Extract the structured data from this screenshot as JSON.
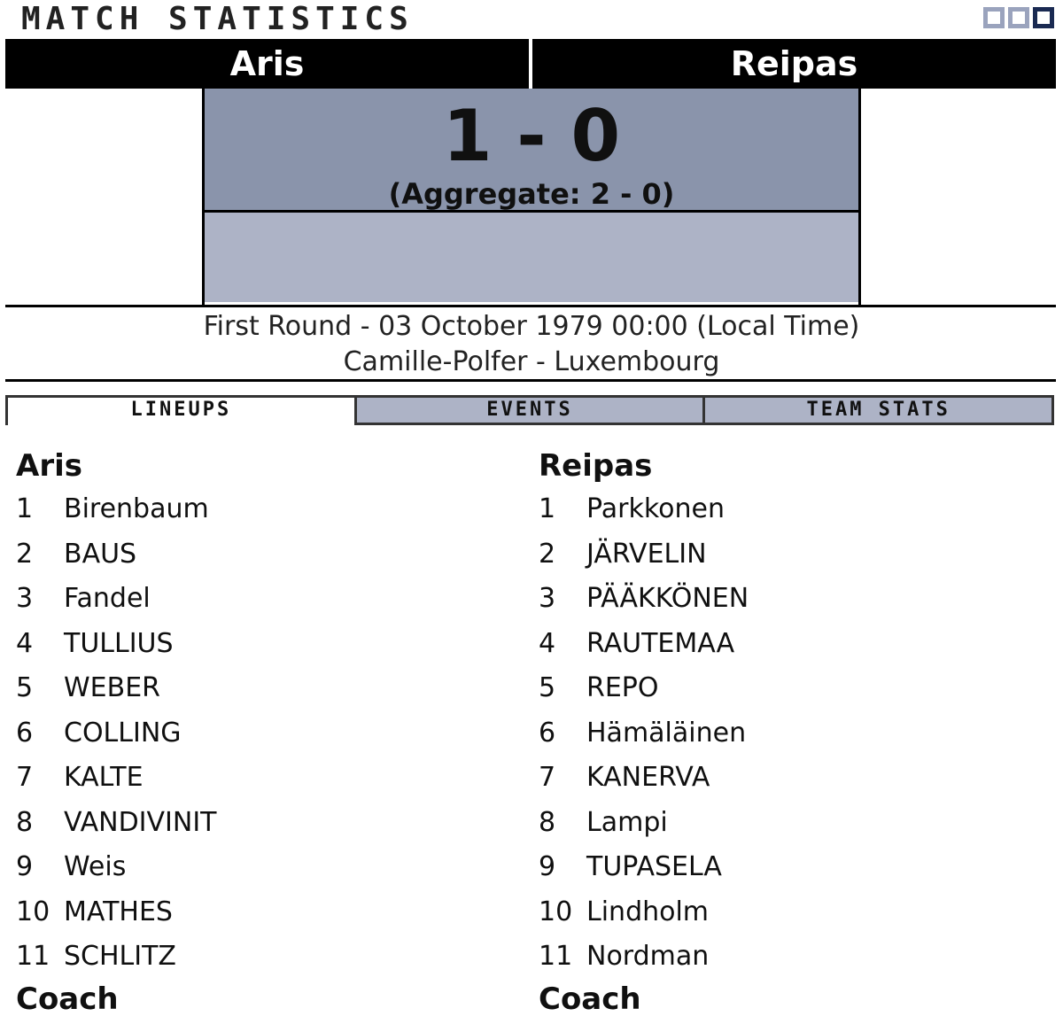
{
  "header": {
    "title": "MATCH STATISTICS"
  },
  "match": {
    "home_team": "Aris",
    "away_team": "Reipas",
    "score": "1 - 0",
    "aggregate": "(Aggregate: 2 - 0)",
    "round_info": "First Round - 03 October 1979 00:00 (Local Time)",
    "venue": "Camille-Polfer - Luxembourg"
  },
  "tabs": [
    "LINEUPS",
    "EVENTS",
    "TEAM STATS"
  ],
  "lineups": {
    "home": {
      "team": "Aris",
      "players": [
        {
          "num": "1",
          "name": "Birenbaum"
        },
        {
          "num": "2",
          "name": "BAUS"
        },
        {
          "num": "3",
          "name": "Fandel"
        },
        {
          "num": "4",
          "name": "TULLIUS"
        },
        {
          "num": "5",
          "name": "WEBER"
        },
        {
          "num": "6",
          "name": "COLLING"
        },
        {
          "num": "7",
          "name": "KALTE"
        },
        {
          "num": "8",
          "name": "VANDIVINIT"
        },
        {
          "num": "9",
          "name": "Weis"
        },
        {
          "num": "10",
          "name": "MATHES"
        },
        {
          "num": "11",
          "name": "SCHLITZ"
        }
      ],
      "coach_label": "Coach"
    },
    "away": {
      "team": "Reipas",
      "players": [
        {
          "num": "1",
          "name": "Parkkonen"
        },
        {
          "num": "2",
          "name": "JÄRVELIN"
        },
        {
          "num": "3",
          "name": "PÄÄKKÖNEN"
        },
        {
          "num": "4",
          "name": "RAUTEMAA"
        },
        {
          "num": "5",
          "name": "REPO"
        },
        {
          "num": "6",
          "name": "Hämäläinen"
        },
        {
          "num": "7",
          "name": "KANERVA"
        },
        {
          "num": "8",
          "name": "Lampi"
        },
        {
          "num": "9",
          "name": "TUPASELA"
        },
        {
          "num": "10",
          "name": "Lindholm"
        },
        {
          "num": "11",
          "name": "Nordman"
        }
      ],
      "coach_label": "Coach"
    }
  }
}
